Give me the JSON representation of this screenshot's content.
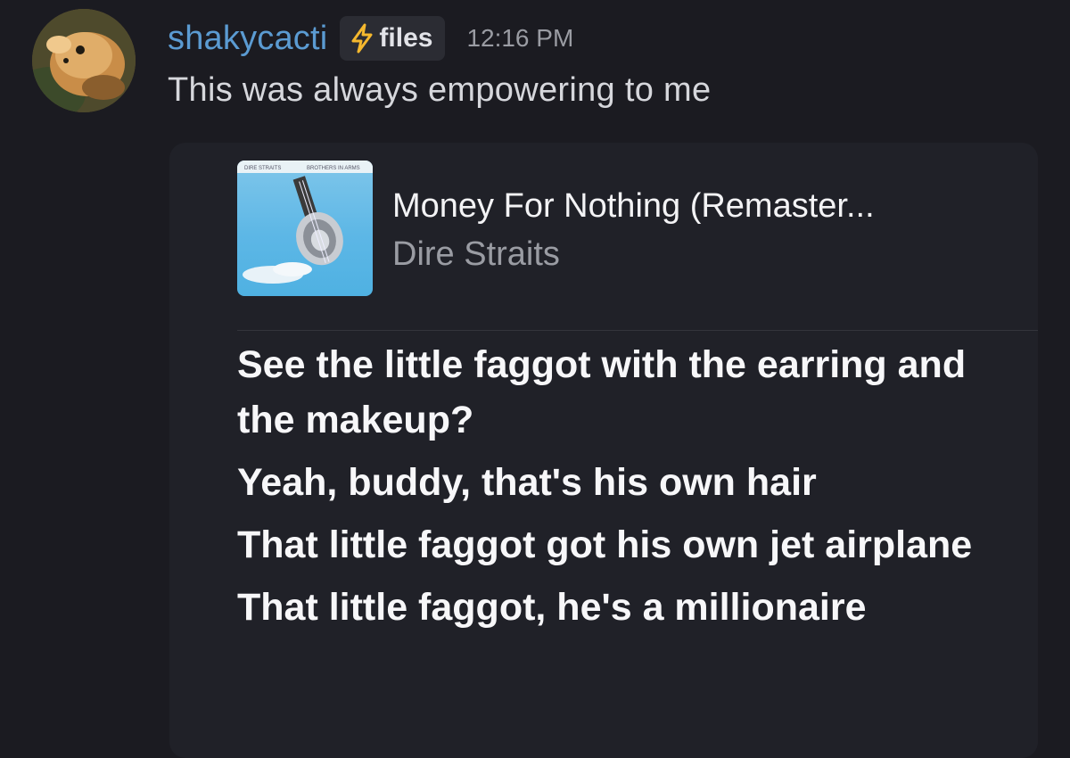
{
  "message": {
    "username": "shakycacti",
    "tag": {
      "icon": "lightning-bolt-icon",
      "label": "files",
      "icon_color": "#f5b82e"
    },
    "timestamp": "12:16 PM",
    "text": "This was always empowering to me",
    "username_color": "#5b9bd2"
  },
  "embed": {
    "album": {
      "left_text": "DIRE STRAITS",
      "right_text": "BROTHERS IN ARMS"
    },
    "song_title": "Money For Nothing (Remaster...",
    "artist": "Dire Straits",
    "lyrics": [
      "See the little faggot with the earring and the makeup?",
      "Yeah, buddy, that's his own hair",
      "That little faggot got his own jet airplane",
      "That little faggot, he's a millionaire"
    ]
  }
}
